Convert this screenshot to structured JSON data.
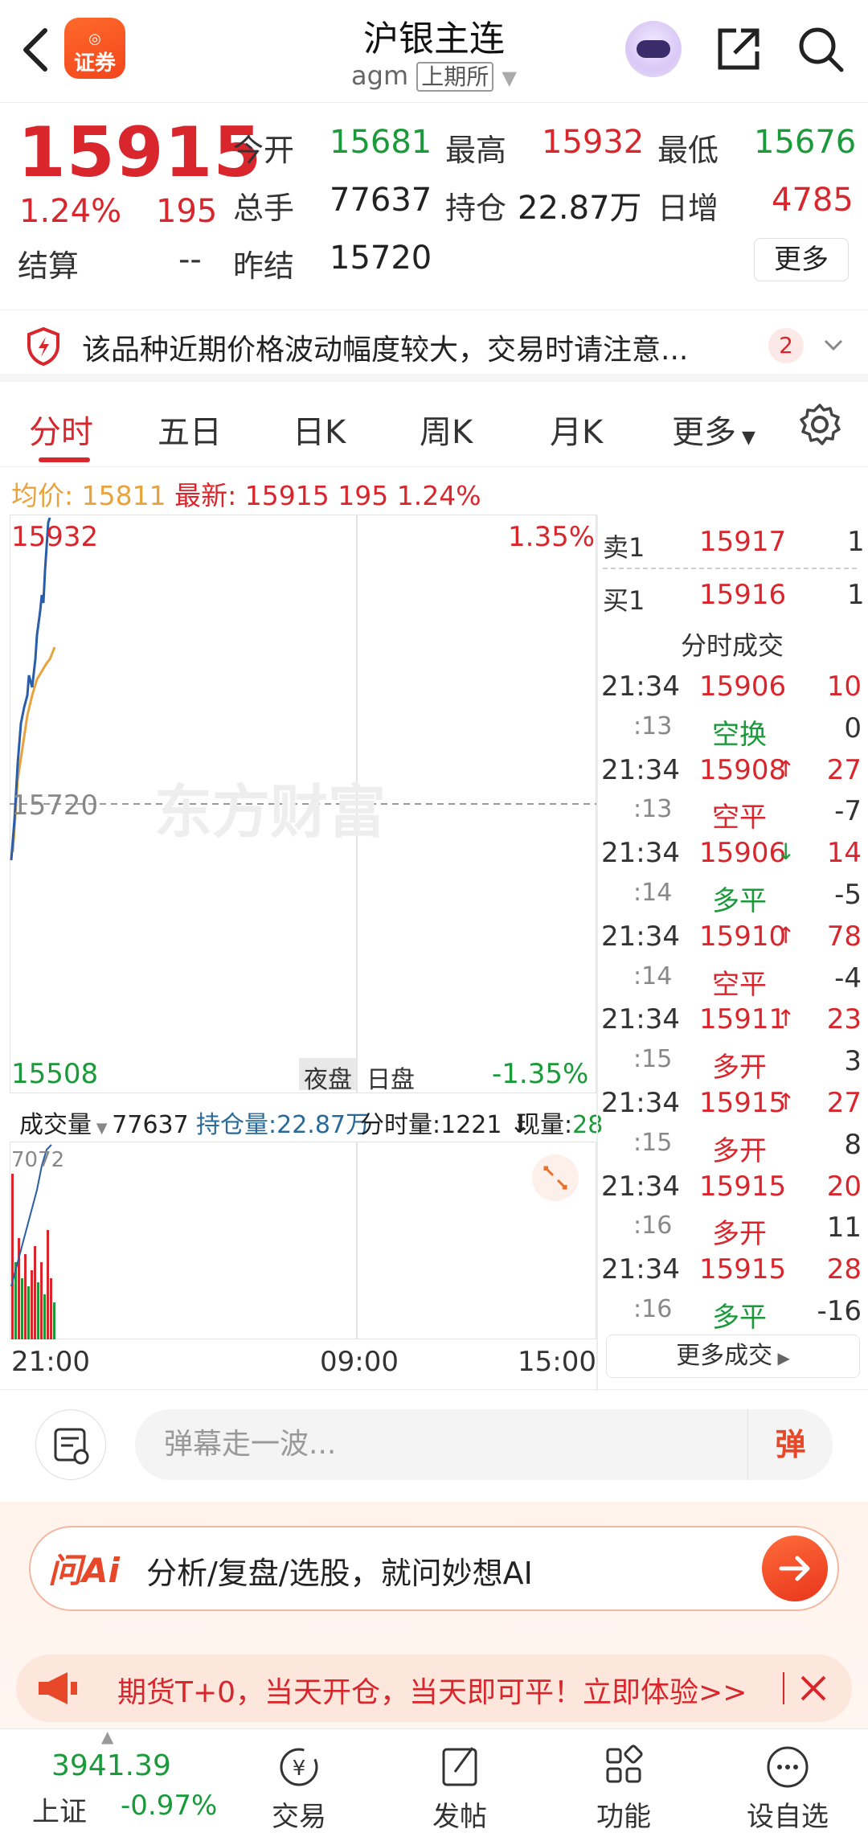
{
  "header": {
    "title": "沪银主连",
    "code": "agm",
    "exchange": "上期所",
    "logo_text": "证券"
  },
  "quote": {
    "price": "15915",
    "change_pct": "1.24%",
    "change": "195",
    "open_label": "今开",
    "open": "15681",
    "high_label": "最高",
    "high": "15932",
    "low_label": "最低",
    "low": "15676",
    "volume_label": "总手",
    "volume": "77637",
    "oi_label": "持仓",
    "oi": "22.87万",
    "daily_inc_label": "日增",
    "daily_inc": "4785",
    "settle_label": "结算",
    "settle": "--",
    "prev_settle_label": "昨结",
    "prev_settle": "15720",
    "more_label": "更多"
  },
  "warning": {
    "text": "该品种近期价格波动幅度较大，交易时请注意...",
    "count": "2"
  },
  "tabs": [
    "分时",
    "五日",
    "日K",
    "周K",
    "月K",
    "更多"
  ],
  "info_line": {
    "avg_label": "均价:",
    "avg": "15811",
    "latest_label": "最新:",
    "latest": "15915",
    "change": "195",
    "pct": "1.24%"
  },
  "chart": {
    "top_price": "15932",
    "top_pct": "1.35%",
    "mid_price": "15720",
    "bottom_price": "15508",
    "bottom_pct": "-1.35%",
    "night_label": "夜盘",
    "day_label": "日盘",
    "watermark": "东方财富",
    "time_labels": [
      "21:00",
      "09:00",
      "15:00"
    ],
    "price_colors": {
      "price_line": "#2a5da8",
      "avg_line": "#e8a33d"
    }
  },
  "volume_bar": {
    "label": "成交量",
    "value": "77637",
    "oi_label": "持仓量:22.87万",
    "tick_label": "分时量:1221",
    "now_label": "现量:",
    "now": "28",
    "max": "7072"
  },
  "orderbook": {
    "sell_label": "卖1",
    "sell_price": "15917",
    "sell_qty": "1",
    "buy_label": "买1",
    "buy_price": "15916",
    "buy_qty": "1",
    "trades_title": "分时成交"
  },
  "trades": [
    {
      "time": "21:34",
      "price": "15906",
      "arrow": "",
      "vol": "10"
    },
    {
      "time": ":13",
      "price": "空换",
      "arrow": "",
      "vol": "0"
    },
    {
      "time": "21:34",
      "price": "15908",
      "arrow": "↑",
      "vol": "27"
    },
    {
      "time": ":13",
      "price": "空平",
      "arrow": "",
      "vol": "-7"
    },
    {
      "time": "21:34",
      "price": "15906",
      "arrow": "↓",
      "vol": "14"
    },
    {
      "time": ":14",
      "price": "多平",
      "arrow": "",
      "vol": "-5"
    },
    {
      "time": "21:34",
      "price": "15910",
      "arrow": "↑",
      "vol": "78"
    },
    {
      "time": ":14",
      "price": "空平",
      "arrow": "",
      "vol": "-4"
    },
    {
      "time": "21:34",
      "price": "15911",
      "arrow": "↑",
      "vol": "23"
    },
    {
      "time": ":15",
      "price": "多开",
      "arrow": "",
      "vol": "3"
    },
    {
      "time": "21:34",
      "price": "15915",
      "arrow": "↑",
      "vol": "27"
    },
    {
      "time": ":15",
      "price": "多开",
      "arrow": "",
      "vol": "8"
    },
    {
      "time": "21:34",
      "price": "15915",
      "arrow": "",
      "vol": "20"
    },
    {
      "time": ":16",
      "price": "多开",
      "arrow": "",
      "vol": "11"
    },
    {
      "time": "21:34",
      "price": "15915",
      "arrow": "",
      "vol": "28"
    },
    {
      "time": ":16",
      "price": "多平",
      "arrow": "",
      "vol": "-16"
    }
  ],
  "more_trades": "更多成交",
  "comment": {
    "placeholder": "弹幕走一波...",
    "button": "弹"
  },
  "ai": {
    "logo": "问Ai",
    "text": "分析/复盘/选股，就问妙想AI"
  },
  "promo": {
    "text": "期货T+0，当天开仓，当天即可平！立即体验>>"
  },
  "bottom_nav": {
    "index_value": "3941.39",
    "index_name": "上证",
    "index_pct": "-0.97%",
    "items": [
      "交易",
      "发帖",
      "功能",
      "设自选"
    ]
  }
}
